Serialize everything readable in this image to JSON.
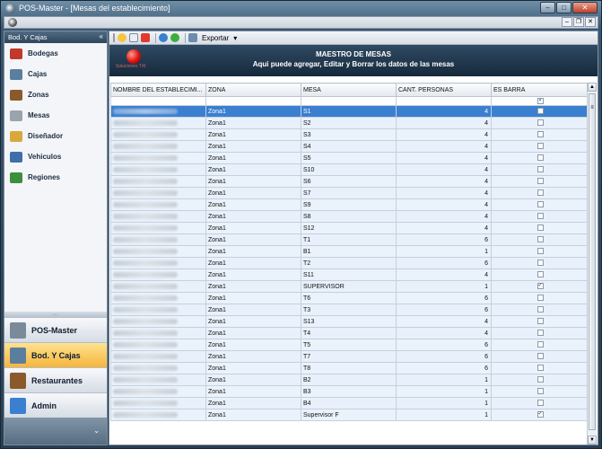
{
  "window": {
    "title": "POS-Master - [Mesas del establecimiento]"
  },
  "title_buttons": {
    "minimize": "–",
    "maximize": "□",
    "close": "✕"
  },
  "mdi_buttons": {
    "minimize": "–",
    "restore": "❐",
    "close": "✕"
  },
  "left_pane": {
    "header": "Bod. Y Cajas",
    "collapse": "«",
    "items": [
      {
        "label": "Bodegas",
        "icon": "warehouse-icon",
        "color": "#c0392b"
      },
      {
        "label": "Cajas",
        "icon": "cash-register-icon",
        "color": "#5a7f9e"
      },
      {
        "label": "Zonas",
        "icon": "zones-icon",
        "color": "#8a5a2b"
      },
      {
        "label": "Mesas",
        "icon": "table-icon",
        "color": "#9aa4ad"
      },
      {
        "label": "Diseñador",
        "icon": "designer-icon",
        "color": "#d8a93a"
      },
      {
        "label": "Vehiculos",
        "icon": "vehicle-icon",
        "color": "#3f6fa8"
      },
      {
        "label": "Regiones",
        "icon": "regions-icon",
        "color": "#3c8f3c"
      }
    ],
    "bottom_items": [
      {
        "label": "POS-Master",
        "icon": "home-icon",
        "active": false
      },
      {
        "label": "Bod. Y Cajas",
        "icon": "cash-register-icon",
        "active": true
      },
      {
        "label": "Restaurantes",
        "icon": "building-icon",
        "active": false
      },
      {
        "label": "Admin",
        "icon": "chart-icon",
        "active": false
      }
    ],
    "footer_chevron": "⌄"
  },
  "toolbar": {
    "export_label": "Exportar",
    "export_arrow": "▾"
  },
  "banner": {
    "logo_text": "Soluciones TXI",
    "title": "MAESTRO DE MESAS",
    "subtitle": "Aqui puede agregar, Editar y Borrar los datos de las mesas"
  },
  "grid": {
    "columns": [
      "NOMBRE DEL ESTABLECIMI...",
      "ZONA",
      "MESA",
      "CANT. PERSONAS",
      "ES BARRA"
    ],
    "rows": [
      {
        "zona": "Zona1",
        "mesa": "S1",
        "personas": "4",
        "barra": false,
        "selected": true
      },
      {
        "zona": "Zona1",
        "mesa": "S2",
        "personas": "4",
        "barra": false
      },
      {
        "zona": "Zona1",
        "mesa": "S3",
        "personas": "4",
        "barra": false
      },
      {
        "zona": "Zona1",
        "mesa": "S4",
        "personas": "4",
        "barra": false
      },
      {
        "zona": "Zona1",
        "mesa": "S5",
        "personas": "4",
        "barra": false
      },
      {
        "zona": "Zona1",
        "mesa": "S10",
        "personas": "4",
        "barra": false
      },
      {
        "zona": "Zona1",
        "mesa": "S6",
        "personas": "4",
        "barra": false
      },
      {
        "zona": "Zona1",
        "mesa": "S7",
        "personas": "4",
        "barra": false
      },
      {
        "zona": "Zona1",
        "mesa": "S9",
        "personas": "4",
        "barra": false
      },
      {
        "zona": "Zona1",
        "mesa": "S8",
        "personas": "4",
        "barra": false
      },
      {
        "zona": "Zona1",
        "mesa": "S12",
        "personas": "4",
        "barra": false
      },
      {
        "zona": "Zona1",
        "mesa": "T1",
        "personas": "6",
        "barra": false
      },
      {
        "zona": "Zona1",
        "mesa": "B1",
        "personas": "1",
        "barra": false
      },
      {
        "zona": "Zona1",
        "mesa": "T2",
        "personas": "6",
        "barra": false
      },
      {
        "zona": "Zona1",
        "mesa": "S11",
        "personas": "4",
        "barra": false
      },
      {
        "zona": "Zona1",
        "mesa": "SUPERVISOR",
        "personas": "1",
        "barra": true
      },
      {
        "zona": "Zona1",
        "mesa": "T6",
        "personas": "6",
        "barra": false
      },
      {
        "zona": "Zona1",
        "mesa": "T3",
        "personas": "6",
        "barra": false
      },
      {
        "zona": "Zona1",
        "mesa": "S13",
        "personas": "4",
        "barra": false
      },
      {
        "zona": "Zona1",
        "mesa": "T4",
        "personas": "4",
        "barra": false
      },
      {
        "zona": "Zona1",
        "mesa": "T5",
        "personas": "6",
        "barra": false
      },
      {
        "zona": "Zona1",
        "mesa": "T7",
        "personas": "6",
        "barra": false
      },
      {
        "zona": "Zona1",
        "mesa": "T8",
        "personas": "6",
        "barra": false
      },
      {
        "zona": "Zona1",
        "mesa": "B2",
        "personas": "1",
        "barra": false
      },
      {
        "zona": "Zona1",
        "mesa": "B3",
        "personas": "1",
        "barra": false
      },
      {
        "zona": "Zona1",
        "mesa": "B4",
        "personas": "1",
        "barra": false
      },
      {
        "zona": "Zona1",
        "mesa": "Supervisor F",
        "personas": "1",
        "barra": true
      }
    ]
  },
  "scrollbar": {
    "up": "▲",
    "down": "▼",
    "grip": "≡"
  }
}
